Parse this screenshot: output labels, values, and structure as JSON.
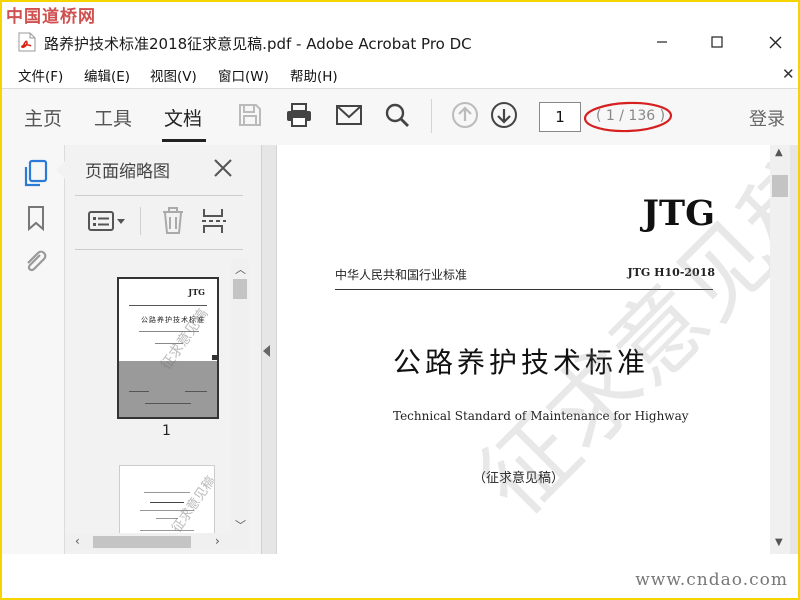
{
  "watermark_top": "中国道桥网",
  "watermark_bottom": "www.cndao.com",
  "window": {
    "title": "路养护技术标准2018征求意见稿.pdf - Adobe Acrobat Pro DC",
    "minimize_label": "—",
    "maximize_label": "☐",
    "close_label": "✕"
  },
  "menu": {
    "file": "文件(F)",
    "edit": "编辑(E)",
    "view": "视图(V)",
    "window": "窗口(W)",
    "help": "帮助(H)"
  },
  "toolbar": {
    "tab_home": "主页",
    "tab_tools": "工具",
    "tab_document": "文档",
    "page_number": "1",
    "page_total": "( 1 / 136 )",
    "login": "登录"
  },
  "thumbnails": {
    "title": "页面缩略图",
    "page1_label": "1",
    "thumb_jtg": "JTG",
    "thumb_title": "公路养护技术标准"
  },
  "document": {
    "jtg": "JTG",
    "header_left": "中华人民共和国行业标准",
    "header_right": "JTG H10-2018",
    "title_cn": "公路养护技术标准",
    "title_en": "Technical Standard of Maintenance for Highway",
    "subtitle": "（征求意见稿）",
    "watermark": "征求意见稿"
  },
  "colors": {
    "frame": "#f5d400",
    "pdf_icon": "#d9261c",
    "watermark_red": "#d05050",
    "highlight_ellipse": "#d62020"
  }
}
